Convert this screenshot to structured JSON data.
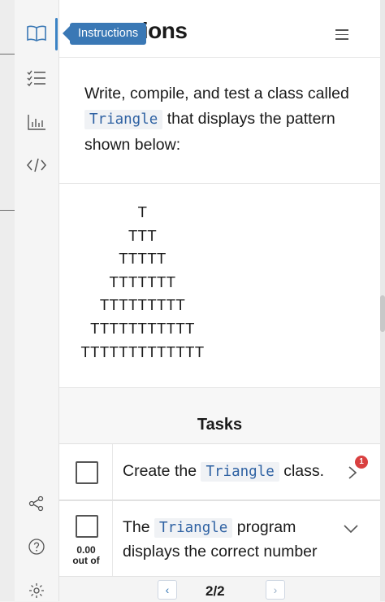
{
  "rail": {
    "icons": [
      "book-icon",
      "checklist-icon",
      "bar-chart-icon",
      "code-icon",
      "share-icon",
      "help-icon",
      "settings-icon"
    ]
  },
  "header": {
    "title": "Instructions",
    "title_visible": "ctions",
    "tooltip": "Instructions"
  },
  "intro": {
    "text_before": "Write, compile, and test a class called",
    "class_name": "Triangle",
    "text_after": "that displays the pattern shown below:"
  },
  "pattern": {
    "lines": [
      "T",
      "TTT",
      "TTTTT",
      "TTTTTTT",
      "TTTTTTTTT",
      "TTTTTTTTTTT",
      "TTTTTTTTTTTTT"
    ]
  },
  "tasks": {
    "title": "Tasks",
    "items": [
      {
        "before": "Create the",
        "code": "Triangle",
        "after": "class.",
        "badge": "1"
      },
      {
        "before": "The",
        "code": "Triangle",
        "after": "program displays the correct number",
        "score": "0.00",
        "score_label": "out of"
      }
    ]
  },
  "pager": {
    "count": "2/2",
    "prev": "‹",
    "next": "›"
  },
  "colors": {
    "accent": "#3a78b5",
    "code_text": "#2f62a3",
    "badge": "#d94040"
  }
}
